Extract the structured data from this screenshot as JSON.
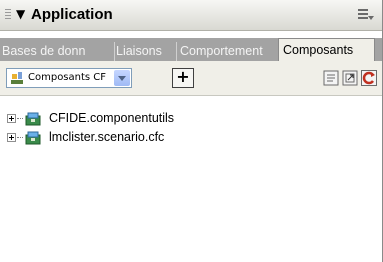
{
  "panel": {
    "title": "Application",
    "collapse_icon": "triangle-down-icon",
    "options_icon": "panel-options-menu-icon"
  },
  "tabs": [
    {
      "label": "Bases de donn",
      "active": false
    },
    {
      "label": "Liaisons",
      "active": false
    },
    {
      "label": "Comportement",
      "active": false
    },
    {
      "label": "Composants",
      "active": true
    }
  ],
  "toolbar": {
    "combo_value": "Composants CF",
    "add_button_label": "+",
    "right_icons": [
      "document-icon",
      "open-page-icon",
      "refresh-icon"
    ]
  },
  "tree": {
    "items": [
      {
        "label": "CFIDE.componentutils",
        "icon": "component-package-icon"
      },
      {
        "label": "lmclister.scenario.cfc",
        "icon": "component-package-icon"
      }
    ]
  },
  "colors": {
    "tab_bar": "#a3a3a3",
    "panel_bg": "#f0efe8",
    "refresh_red": "#c03020"
  }
}
